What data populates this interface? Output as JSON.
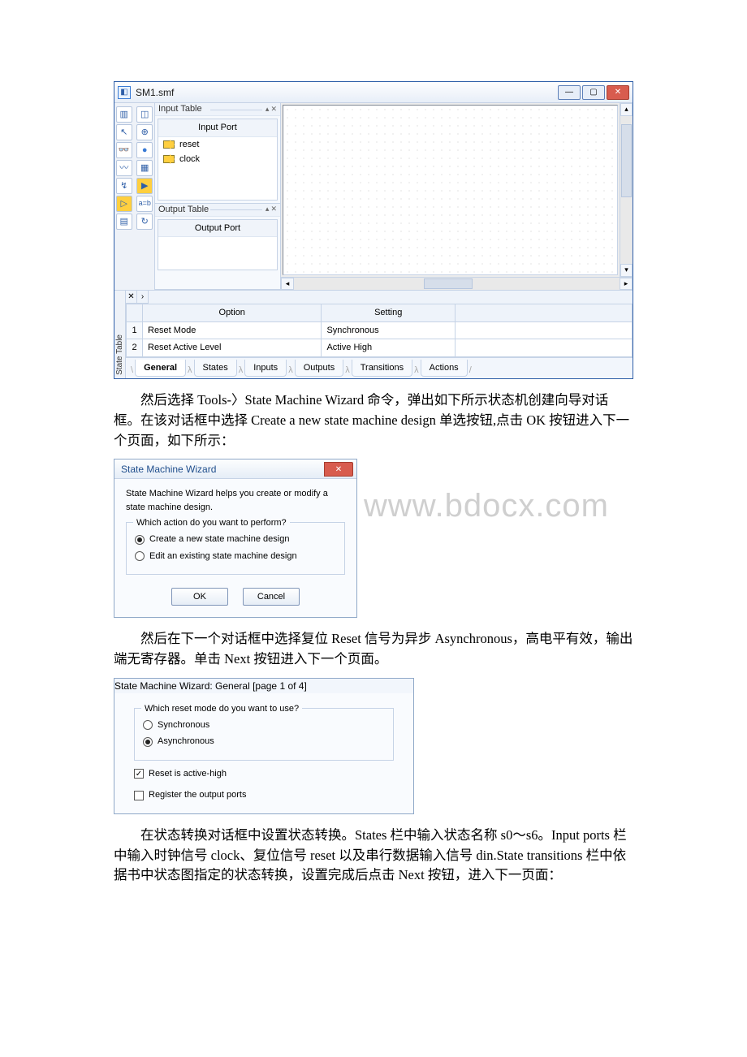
{
  "fig1": {
    "title": "SM1.smf",
    "input_table": {
      "header": "Input Table",
      "port_header": "Input Port",
      "ports": [
        "reset",
        "clock"
      ]
    },
    "output_table": {
      "header": "Output Table",
      "port_header": "Output Port"
    },
    "options_table": {
      "col_option": "Option",
      "col_setting": "Setting",
      "rows": [
        {
          "n": "1",
          "opt": "Reset Mode",
          "set": "Synchronous"
        },
        {
          "n": "2",
          "opt": "Reset Active Level",
          "set": "Active High"
        }
      ]
    },
    "state_table_label": "State Table",
    "tabs": [
      "General",
      "States",
      "Inputs",
      "Outputs",
      "Transitions",
      "Actions"
    ]
  },
  "para1": "然后选择 Tools-〉State Machine Wizard 命令，弹出如下所示状态机创建向导对话框。在该对话框中选择 Create a new state machine design 单选按钮,点击 OK 按钮进入下一个页面，如下所示：",
  "fig2": {
    "title": "State Machine Wizard",
    "desc": "State Machine Wizard helps you create or modify a state machine design.",
    "groupbox": "Which action do you want to perform?",
    "opt_create": "Create a new state machine design",
    "opt_edit": "Edit an existing state machine design",
    "ok": "OK",
    "cancel": "Cancel"
  },
  "watermark": "www.bdocx.com",
  "para2": "然后在下一个对话框中选择复位 Reset 信号为异步 Asynchronous，高电平有效，输出端无寄存器。单击 Next 按钮进入下一个页面。",
  "fig3": {
    "title": "State Machine Wizard: General [page 1 of 4]",
    "groupbox": "Which reset mode do you want to use?",
    "opt_sync": "Synchronous",
    "opt_async": "Asynchronous",
    "chk_activehigh": "Reset is active-high",
    "chk_register": "Register the output ports"
  },
  "para3": "在状态转换对话框中设置状态转换。States 栏中输入状态名称 s0～s6。Input ports 栏中输入时钟信号 clock、复位信号 reset 以及串行数据输入信号 din.State transitions 栏中依据书中状态图指定的状态转换，设置完成后点击 Next 按钮，进入下一页面："
}
